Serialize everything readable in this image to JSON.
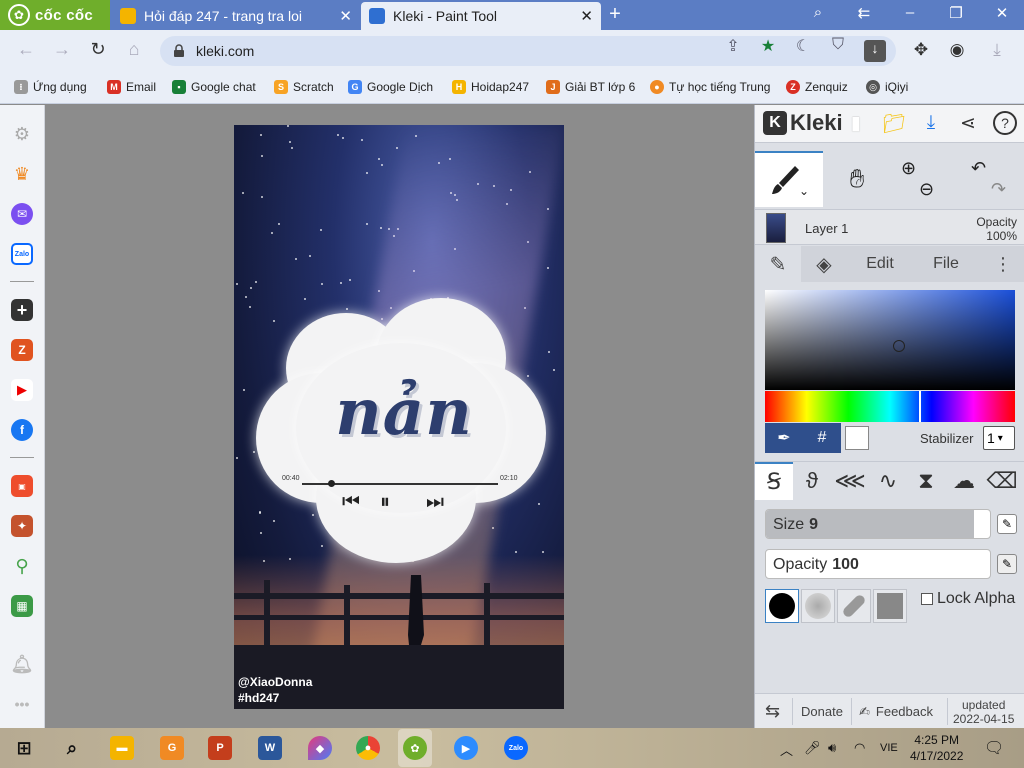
{
  "browser": {
    "brand": "cốc cốc",
    "tabs": [
      {
        "title": "Hỏi đáp 247 - trang tra loi",
        "close": "✕"
      },
      {
        "title": "Kleki - Paint Tool",
        "close": "✕"
      }
    ],
    "new_tab": "+",
    "url": "kleki.com",
    "window_controls": {
      "minimize": "–",
      "restore": "❐",
      "close": "✕"
    }
  },
  "bookmarks": [
    {
      "label": "Ứng dụng",
      "icon": "apps-grid-icon",
      "color": "#888888"
    },
    {
      "label": "Email",
      "icon": "gmail-icon",
      "color": "#d93025"
    },
    {
      "label": "Google chat",
      "icon": "google-chat-icon",
      "color": "#188038"
    },
    {
      "label": "Scratch",
      "icon": "scratch-icon",
      "color": "#f7a325"
    },
    {
      "label": "Google Dịch",
      "icon": "google-translate-icon",
      "color": "#4285f4"
    },
    {
      "label": "Hoidap247",
      "icon": "hoidap247-icon",
      "color": "#f4b400"
    },
    {
      "label": "Giải BT lớp 6",
      "icon": "giaibt-icon",
      "color": "#e06c1b"
    },
    {
      "label": "Tự học tiếng Trung",
      "icon": "tuhoc-icon",
      "color": "#f08a24"
    },
    {
      "label": "Zenquiz",
      "icon": "zenquiz-icon",
      "color": "#d93025"
    },
    {
      "label": "iQiyi",
      "icon": "iqiyi-icon",
      "color": "#555555"
    }
  ],
  "artwork": {
    "lyric": "nản",
    "time_start": "00:40",
    "time_end": "02:10",
    "watermark_1": "@XiaoDonna",
    "watermark_2": "#hd247"
  },
  "kleki": {
    "logo": "Kleki",
    "layer": {
      "name": "Layer 1",
      "opacity_label": "Opacity",
      "opacity_value": "100%"
    },
    "tabs": {
      "edit": "Edit",
      "file": "File"
    },
    "picker_hash": "#",
    "stabilizer_label": "Stabilizer",
    "stabilizer_value": "1",
    "size": {
      "label": "Size",
      "value": "9",
      "fraction": 0.93
    },
    "opacity": {
      "label": "Opacity",
      "value": "100",
      "fraction": 0.0
    },
    "lock_alpha": "Lock Alpha",
    "footer": {
      "donate": "Donate",
      "feedback": "Feedback",
      "updated_label": "updated",
      "updated_date": "2022-04-15"
    },
    "colors": {
      "accent": "#3b82c4",
      "primary_swatch": "#000000",
      "secondary_swatch": "#ffffff"
    }
  },
  "taskbar": {
    "language": "VIE",
    "time": "4:25 PM",
    "date": "4/17/2022"
  }
}
